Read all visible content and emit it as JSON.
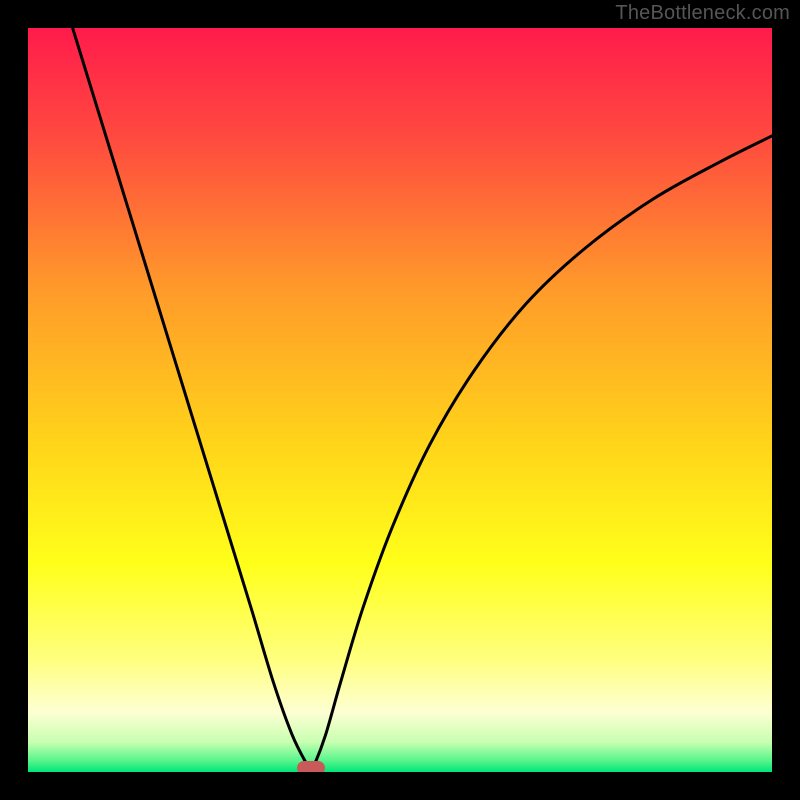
{
  "watermark": "TheBottleneck.com",
  "chart_data": {
    "type": "line",
    "title": "",
    "xlabel": "",
    "ylabel": "",
    "xlim": [
      0,
      100
    ],
    "ylim": [
      0,
      100
    ],
    "gradient_stops": [
      {
        "pct": 0,
        "color": "#ff1b4b"
      },
      {
        "pct": 15,
        "color": "#ff4b3f"
      },
      {
        "pct": 35,
        "color": "#ff9a2a"
      },
      {
        "pct": 55,
        "color": "#ffd21a"
      },
      {
        "pct": 72,
        "color": "#ffff1a"
      },
      {
        "pct": 85,
        "color": "#ffff80"
      },
      {
        "pct": 92,
        "color": "#fdffd3"
      },
      {
        "pct": 96,
        "color": "#c7ffb0"
      },
      {
        "pct": 98.5,
        "color": "#55f58b"
      },
      {
        "pct": 100,
        "color": "#00e57a"
      }
    ],
    "series": [
      {
        "name": "bottleneck-curve",
        "x": [
          6,
          10,
          14,
          18,
          22,
          26,
          30,
          33,
          35.5,
          37.5,
          38,
          38.5,
          40,
          42,
          45,
          49,
          54,
          60,
          67,
          75,
          84,
          93,
          100
        ],
        "y": [
          100,
          87,
          74,
          61,
          48,
          35,
          22,
          12,
          5,
          1,
          0.4,
          1,
          5,
          12,
          22,
          33,
          44,
          54,
          63,
          70.5,
          77,
          82,
          85.5
        ]
      }
    ],
    "marker": {
      "x": 38.0,
      "y": 0.5,
      "color": "#c95a5a"
    }
  }
}
